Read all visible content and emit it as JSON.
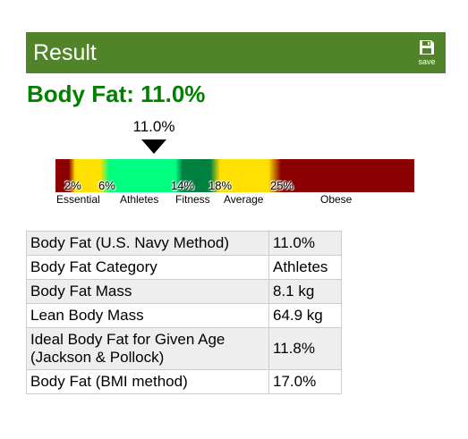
{
  "header": {
    "title": "Result",
    "save_label": "save"
  },
  "headline": "Body Fat: 11.0%",
  "scale": {
    "marker_value_label": "11.0%",
    "marker_percent": 11.0,
    "ticks": [
      {
        "label": "2%",
        "percent": 2
      },
      {
        "label": "6%",
        "percent": 6
      },
      {
        "label": "14%",
        "percent": 14
      },
      {
        "label": "18%",
        "percent": 18
      },
      {
        "label": "25%",
        "percent": 25
      }
    ],
    "categories": [
      "Essential",
      "Athletes",
      "Fitness",
      "Average",
      "Obese"
    ],
    "colors": {
      "essential_red": "#8b0000",
      "yellow": "#ffe000",
      "athletes_green": "#00ff80",
      "fitness_green": "#008040"
    }
  },
  "table": {
    "rows": [
      {
        "label": "Body Fat (U.S. Navy Method)",
        "value": "11.0%"
      },
      {
        "label": "Body Fat Category",
        "value": "Athletes"
      },
      {
        "label": "Body Fat Mass",
        "value": "8.1 kg"
      },
      {
        "label": "Lean Body Mass",
        "value": "64.9 kg"
      },
      {
        "label": "Ideal Body Fat for Given Age (Jackson & Pollock)",
        "value": "11.8%"
      },
      {
        "label": "Body Fat (BMI method)",
        "value": "17.0%"
      }
    ]
  },
  "colors": {
    "header_bg": "#518428",
    "headline_text": "#008000",
    "table_border": "#cccccc",
    "table_stripe": "#eeeeee"
  }
}
